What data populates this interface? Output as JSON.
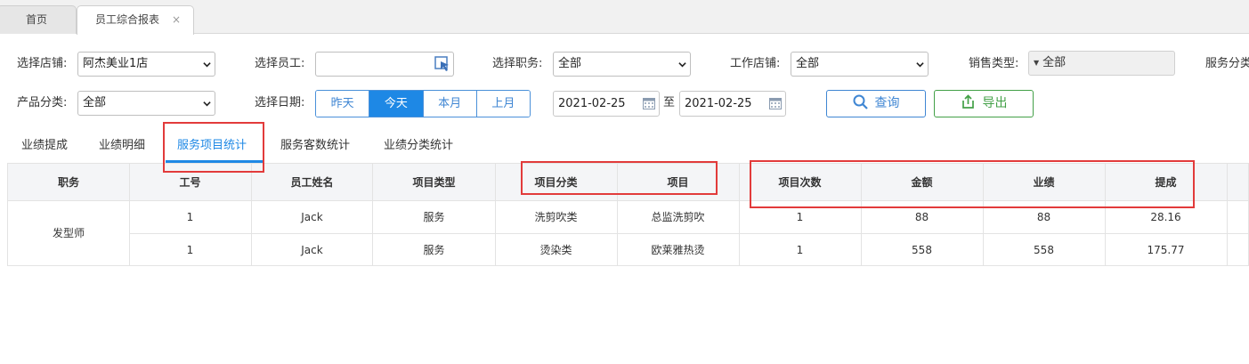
{
  "tabs": {
    "home": "首页",
    "active": "员工综合报表",
    "close": "×"
  },
  "filters": {
    "store_label": "选择店铺:",
    "store_value": "阿杰美业1店",
    "employee_label": "选择员工:",
    "employee_value": "",
    "position_label": "选择职务:",
    "position_value": "全部",
    "work_store_label": "工作店铺:",
    "work_store_value": "全部",
    "sales_type_label": "销售类型:",
    "sales_type_value": "全部",
    "service_category_label": "服务分类",
    "product_category_label": "产品分类:",
    "product_category_value": "全部",
    "date_label": "选择日期:",
    "date_buttons": [
      "昨天",
      "今天",
      "本月",
      "上月"
    ],
    "date_active": "今天",
    "date_from": "2021-02-25",
    "date_to_sep": "至",
    "date_to": "2021-02-25",
    "query_label": "查询",
    "export_label": "导出"
  },
  "subtabs": [
    "业绩提成",
    "业绩明细",
    "服务项目统计",
    "服务客数统计",
    "业绩分类统计"
  ],
  "subtab_active": "服务项目统计",
  "table": {
    "columns": [
      "职务",
      "工号",
      "员工姓名",
      "项目类型",
      "项目分类",
      "项目",
      "项目次数",
      "金额",
      "业绩",
      "提成"
    ],
    "group_label": "发型师",
    "rows": [
      [
        "1",
        "Jack",
        "服务",
        "洗剪吹类",
        "总监洗剪吹",
        "1",
        "88",
        "88",
        "28.16"
      ],
      [
        "1",
        "Jack",
        "服务",
        "烫染类",
        "欧莱雅热烫",
        "1",
        "558",
        "558",
        "175.77"
      ]
    ]
  },
  "colors": {
    "accent": "#1e88e5",
    "export_green": "#43a047",
    "highlight_red": "#e23b3b"
  }
}
